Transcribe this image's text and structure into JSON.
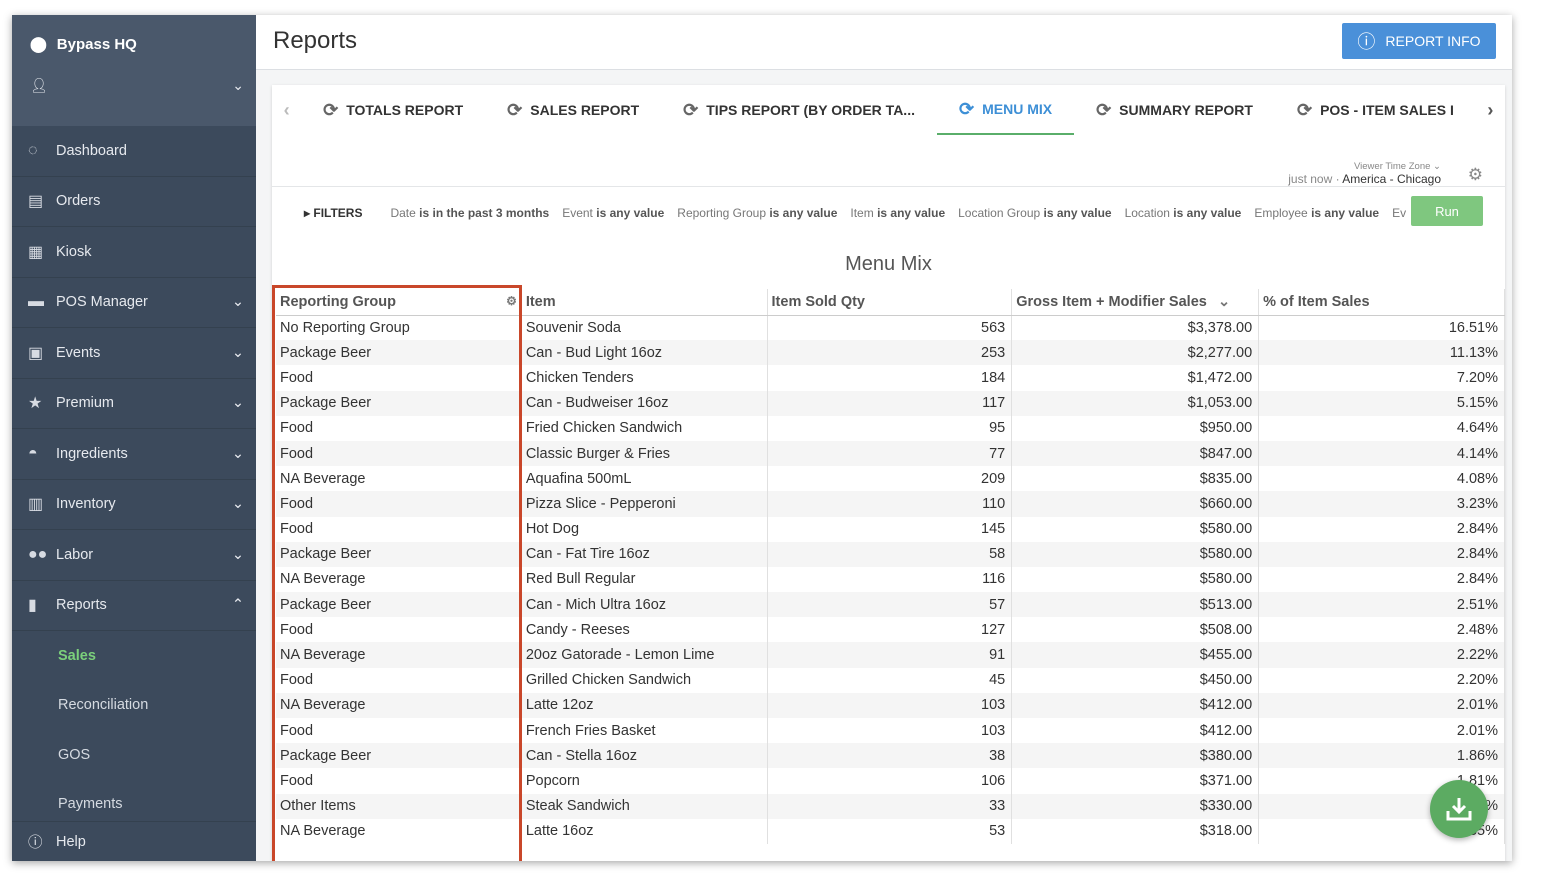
{
  "sidebar": {
    "location": "Bypass HQ",
    "items": [
      {
        "label": "Dashboard",
        "icon": "◌",
        "chev": ""
      },
      {
        "label": "Orders",
        "icon": "▤",
        "chev": ""
      },
      {
        "label": "Kiosk",
        "icon": "▦",
        "chev": ""
      },
      {
        "label": "POS Manager",
        "icon": "▬",
        "chev": "⌄"
      },
      {
        "label": "Events",
        "icon": "▣",
        "chev": "⌄"
      },
      {
        "label": "Premium",
        "icon": "★",
        "chev": "⌄"
      },
      {
        "label": "Ingredients",
        "icon": "◓",
        "chev": "⌄"
      },
      {
        "label": "Inventory",
        "icon": "▥",
        "chev": "⌄"
      },
      {
        "label": "Labor",
        "icon": "●●",
        "chev": "⌄"
      },
      {
        "label": "Reports",
        "icon": "▮",
        "chev": "⌃"
      }
    ],
    "subitems": [
      "Sales",
      "Reconciliation",
      "GOS",
      "Payments"
    ],
    "help": "Help"
  },
  "header": {
    "title": "Reports",
    "info_button": "REPORT INFO"
  },
  "tabs": [
    "TOTALS REPORT",
    "SALES REPORT",
    "TIPS REPORT (BY ORDER TA...",
    "MENU MIX",
    "SUMMARY REPORT",
    "POS - ITEM SALES I"
  ],
  "active_tab": "MENU MIX",
  "timezone": {
    "label": "Viewer Time Zone",
    "updated": "just now",
    "value": "America - Chicago"
  },
  "filters": {
    "label": "FILTERS",
    "items": [
      [
        "Date",
        "is in the past 3 months"
      ],
      [
        "Event",
        "is any value"
      ],
      [
        "Reporting Group",
        "is any value"
      ],
      [
        "Item",
        "is any value"
      ],
      [
        "Location Group",
        "is any value"
      ],
      [
        "Location",
        "is any value"
      ],
      [
        "Employee",
        "is any value"
      ],
      [
        "Ev",
        ""
      ]
    ],
    "run": "Run"
  },
  "report_title": "Menu Mix",
  "table": {
    "columns": [
      "Reporting Group",
      "Item",
      "Item Sold Qty",
      "Gross Item + Modifier Sales",
      "% of Item Sales"
    ],
    "rows": [
      [
        "No Reporting Group",
        "Souvenir Soda",
        "563",
        "$3,378.00",
        "16.51%"
      ],
      [
        "Package Beer",
        "Can - Bud Light 16oz",
        "253",
        "$2,277.00",
        "11.13%"
      ],
      [
        "Food",
        "Chicken Tenders",
        "184",
        "$1,472.00",
        "7.20%"
      ],
      [
        "Package Beer",
        "Can - Budweiser 16oz",
        "117",
        "$1,053.00",
        "5.15%"
      ],
      [
        "Food",
        "Fried Chicken Sandwich",
        "95",
        "$950.00",
        "4.64%"
      ],
      [
        "Food",
        "Classic Burger & Fries",
        "77",
        "$847.00",
        "4.14%"
      ],
      [
        "NA Beverage",
        "Aquafina 500mL",
        "209",
        "$835.00",
        "4.08%"
      ],
      [
        "Food",
        "Pizza Slice - Pepperoni",
        "110",
        "$660.00",
        "3.23%"
      ],
      [
        "Food",
        "Hot Dog",
        "145",
        "$580.00",
        "2.84%"
      ],
      [
        "Package Beer",
        "Can - Fat Tire 16oz",
        "58",
        "$580.00",
        "2.84%"
      ],
      [
        "NA Beverage",
        "Red Bull Regular",
        "116",
        "$580.00",
        "2.84%"
      ],
      [
        "Package Beer",
        "Can - Mich Ultra 16oz",
        "57",
        "$513.00",
        "2.51%"
      ],
      [
        "Food",
        "Candy - Reeses",
        "127",
        "$508.00",
        "2.48%"
      ],
      [
        "NA Beverage",
        "20oz Gatorade - Lemon Lime",
        "91",
        "$455.00",
        "2.22%"
      ],
      [
        "Food",
        "Grilled Chicken Sandwich",
        "45",
        "$450.00",
        "2.20%"
      ],
      [
        "NA Beverage",
        "Latte 12oz",
        "103",
        "$412.00",
        "2.01%"
      ],
      [
        "Food",
        "French Fries Basket",
        "103",
        "$412.00",
        "2.01%"
      ],
      [
        "Package Beer",
        "Can - Stella 16oz",
        "38",
        "$380.00",
        "1.86%"
      ],
      [
        "Food",
        "Popcorn",
        "106",
        "$371.00",
        "1.81%"
      ],
      [
        "Other Items",
        "Steak Sandwich",
        "33",
        "$330.00",
        "1.61%"
      ],
      [
        "NA Beverage",
        "Latte 16oz",
        "53",
        "$318.00",
        "1.55%"
      ]
    ]
  },
  "colors": {
    "sidebar": "#3c4a5c",
    "accent": "#4a90d9",
    "active_green": "#5cab62",
    "highlight": "#c9472a"
  }
}
